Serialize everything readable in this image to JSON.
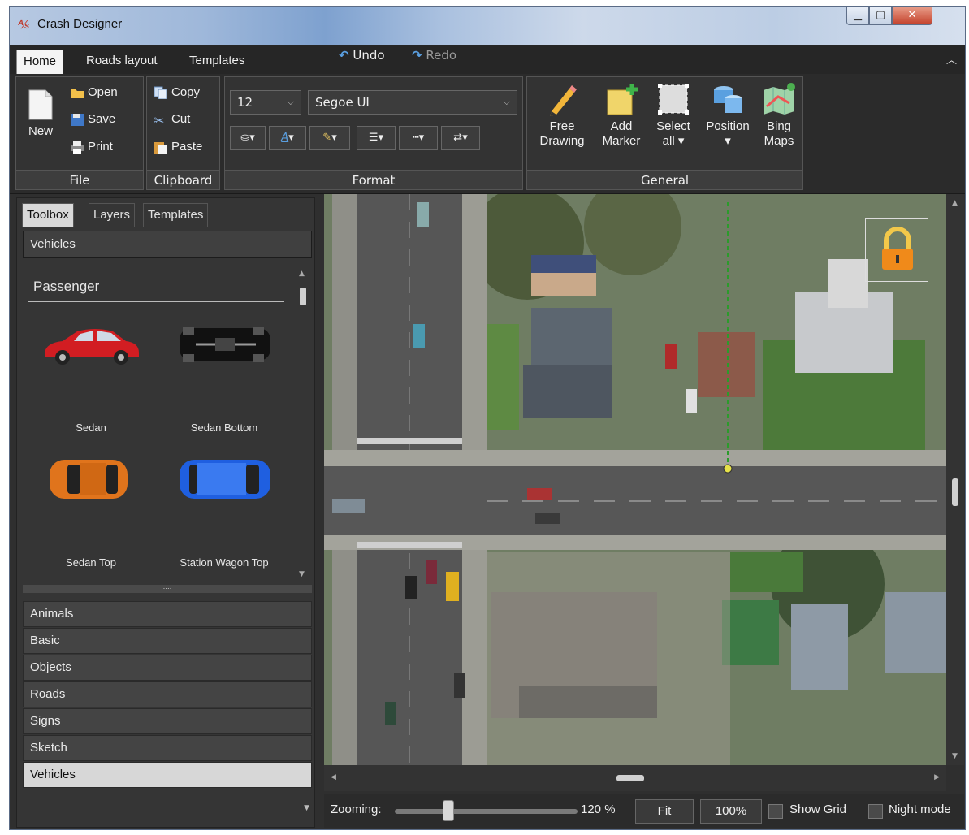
{
  "window": {
    "title": "Crash Designer",
    "icon": "crash-designer-logo"
  },
  "ribbon_tabs": [
    "Home",
    "Roads layout",
    "Templates"
  ],
  "quick_access": {
    "undo": "Undo",
    "redo": "Redo"
  },
  "groups": {
    "file": {
      "label": "File",
      "new": "New",
      "open": "Open",
      "save": "Save",
      "print": "Print"
    },
    "clipboard": {
      "label": "Clipboard",
      "copy": "Copy",
      "cut": "Cut",
      "paste": "Paste"
    },
    "format": {
      "label": "Format",
      "font_size": "12",
      "font_name": "Segoe UI"
    },
    "general": {
      "label": "General",
      "free_drawing": [
        "Free",
        "Drawing"
      ],
      "add_marker": [
        "Add",
        "Marker"
      ],
      "select_all": [
        "Select",
        "all"
      ],
      "position": [
        "Position",
        ""
      ],
      "bing_maps": [
        "Bing",
        "Maps"
      ]
    }
  },
  "left_panel": {
    "tabs": [
      "Toolbox",
      "Layers",
      "Templates"
    ],
    "section": "Vehicles",
    "subsection": "Passenger",
    "vehicles": [
      "Sedan",
      "Sedan Bottom",
      "Sedan Top",
      "Station Wagon Top"
    ],
    "categories": [
      "Animals",
      "Basic",
      "Objects",
      "Roads",
      "Signs",
      "Sketch",
      "Vehicles"
    ],
    "selected_category": "Vehicles"
  },
  "statusbar": {
    "zoom_label": "Zooming:",
    "zoom_value": "120 %",
    "zoom_fraction": 0.28,
    "fit": "Fit",
    "hundred": "100%",
    "show_grid": "Show Grid",
    "night_mode": "Night mode"
  },
  "colors": {
    "accent": "#5a9fe0",
    "panel": "#353535",
    "ribbon": "#2b2b2b"
  }
}
